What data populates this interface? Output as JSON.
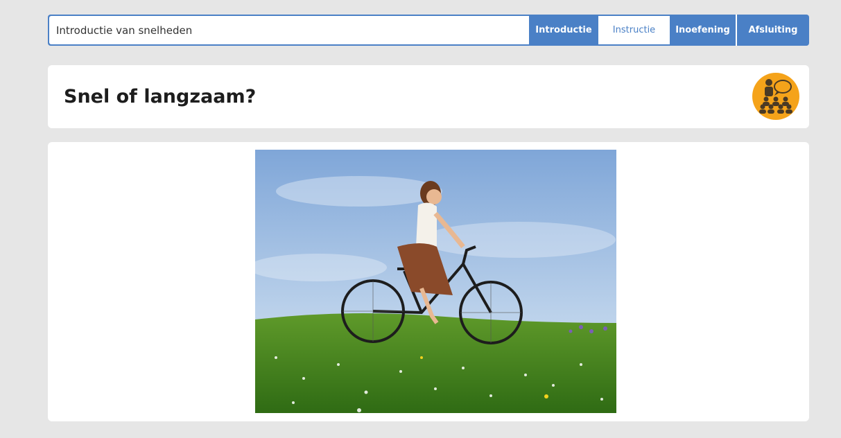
{
  "lesson": {
    "title": "Introductie van snelheden"
  },
  "tabs": [
    {
      "label": "Introductie",
      "active": false
    },
    {
      "label": "Instructie",
      "active": true
    },
    {
      "label": "Inoefening",
      "active": false
    },
    {
      "label": "Afsluiting",
      "active": false
    }
  ],
  "page": {
    "title": "Snel of langzaam?",
    "mode_icon": "classroom-discussion-icon"
  },
  "content": {
    "image_icon": "woman-cycling-photo"
  },
  "colors": {
    "accent": "#4a80c6",
    "badge": "#f5a31a",
    "background": "#e6e6e6"
  }
}
